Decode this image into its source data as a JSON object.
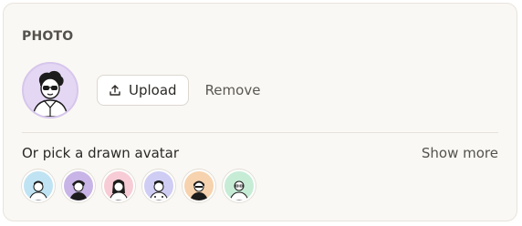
{
  "section": {
    "title": "PHOTO"
  },
  "photo": {
    "upload_label": "Upload",
    "remove_label": "Remove",
    "current_avatar_bg": "#e4d7f4"
  },
  "drawn": {
    "label": "Or pick a drawn avatar",
    "show_more_label": "Show more",
    "avatars": [
      {
        "name": "avatar-option-1",
        "bg": "#bfe3f2"
      },
      {
        "name": "avatar-option-2",
        "bg": "#c8b4e6"
      },
      {
        "name": "avatar-option-3",
        "bg": "#f7ccd6"
      },
      {
        "name": "avatar-option-4",
        "bg": "#cfcdf4"
      },
      {
        "name": "avatar-option-5",
        "bg": "#f6d3ae"
      },
      {
        "name": "avatar-option-6",
        "bg": "#c6ecd6"
      }
    ]
  }
}
